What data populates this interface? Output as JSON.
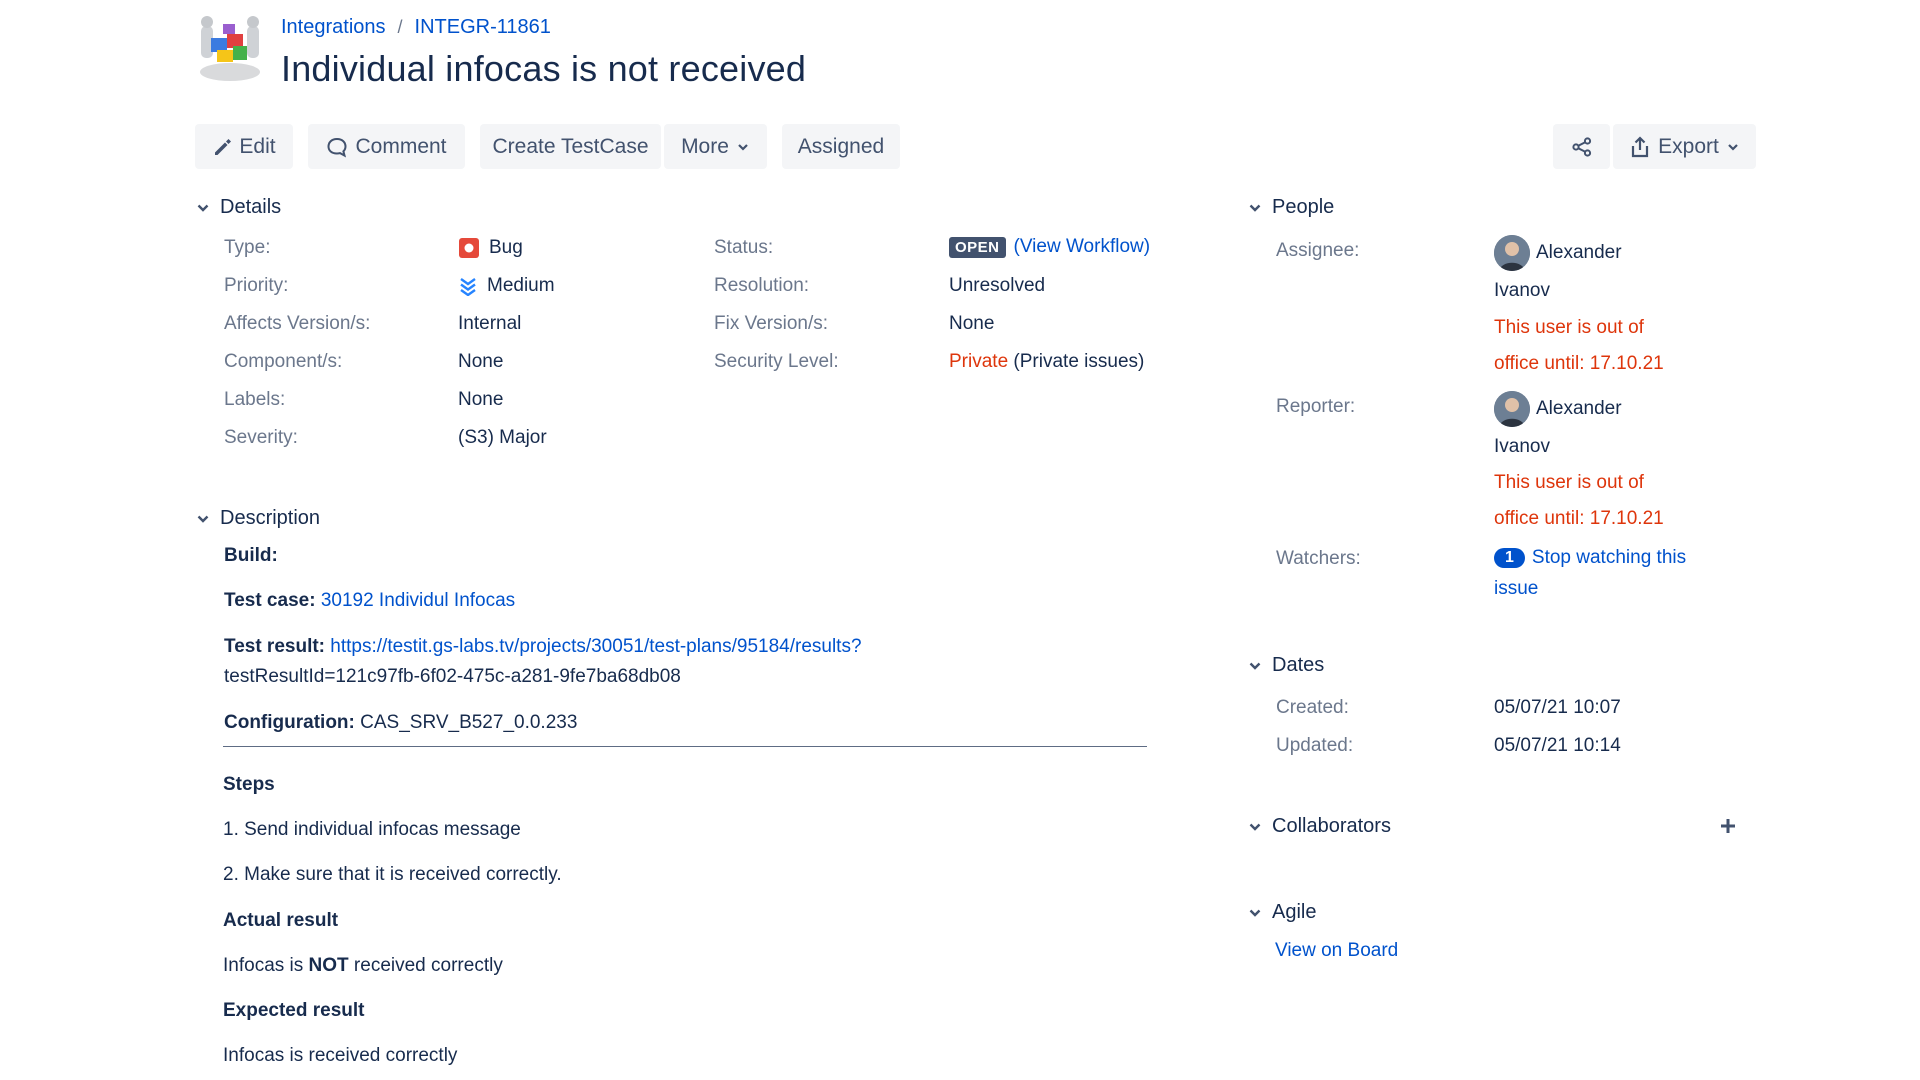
{
  "breadcrumb": {
    "project": "Integrations",
    "separator": "/",
    "issue_key": "INTEGR-11861"
  },
  "title": "Individual infocas is not received",
  "toolbar": {
    "edit": "Edit",
    "comment": "Comment",
    "create_testcase": "Create TestCase",
    "more": "More",
    "assigned": "Assigned",
    "export": "Export"
  },
  "details": {
    "heading": "Details",
    "type_label": "Type:",
    "type_value": "Bug",
    "priority_label": "Priority:",
    "priority_value": "Medium",
    "affects_label": "Affects Version/s:",
    "affects_value": "Internal",
    "component_label": "Component/s:",
    "component_value": "None",
    "labels_label": "Labels:",
    "labels_value": "None",
    "severity_label": "Severity:",
    "severity_value": "(S3) Major",
    "status_label": "Status:",
    "status_value": "OPEN",
    "view_workflow": "(View Workflow)",
    "resolution_label": "Resolution:",
    "resolution_value": "Unresolved",
    "fix_label": "Fix Version/s:",
    "fix_value": "None",
    "security_label": "Security Level:",
    "security_value": "Private",
    "security_note": "(Private issues)"
  },
  "description": {
    "heading": "Description",
    "build_label": "Build:",
    "testcase_label": "Test case:",
    "testcase_link": "30192 Individul Infocas",
    "testresult_label": "Test result:",
    "testresult_link_1": "https://testit.gs-labs.tv/projects/30051/test-plans/95184/results?",
    "testresult_link_2": "testResultId=121c97fb-6f02-475c-a281-9fe7ba68db08",
    "config_label": "Configuration:",
    "config_value": "CAS_SRV_B527_0.0.233",
    "steps_heading": "Steps",
    "step1": "1. Send individual infocas message",
    "step2": "2. Make sure that it is received correctly.",
    "actual_heading": "Actual result",
    "actual_pre": "Infocas is ",
    "actual_bold": "NOT",
    "actual_post": " received correctly",
    "expected_heading": "Expected result",
    "expected_text": "Infocas is received correctly"
  },
  "people": {
    "heading": "People",
    "assignee_label": "Assignee:",
    "assignee_first": "Alexander",
    "assignee_last": "Ivanov",
    "assignee_ooo_1": "This user is out of",
    "assignee_ooo_2": "office until: 17.10.21",
    "reporter_label": "Reporter:",
    "reporter_first": "Alexander",
    "reporter_last": "Ivanov",
    "reporter_ooo_1": "This user is out of",
    "reporter_ooo_2": "office until: 17.10.21",
    "watchers_label": "Watchers:",
    "watchers_count": "1",
    "watch_link_1": "Stop watching this",
    "watch_link_2": "issue"
  },
  "dates": {
    "heading": "Dates",
    "created_label": "Created:",
    "created_value": "05/07/21 10:07",
    "updated_label": "Updated:",
    "updated_value": "05/07/21 10:14"
  },
  "collaborators": {
    "heading": "Collaborators"
  },
  "agile": {
    "heading": "Agile",
    "view_on_board": "View on Board"
  },
  "colors": {
    "link": "#0052cc",
    "warning_red": "#de350b",
    "button_bg": "#f4f5f7",
    "text": "#172b4d",
    "label": "#6b778c"
  }
}
